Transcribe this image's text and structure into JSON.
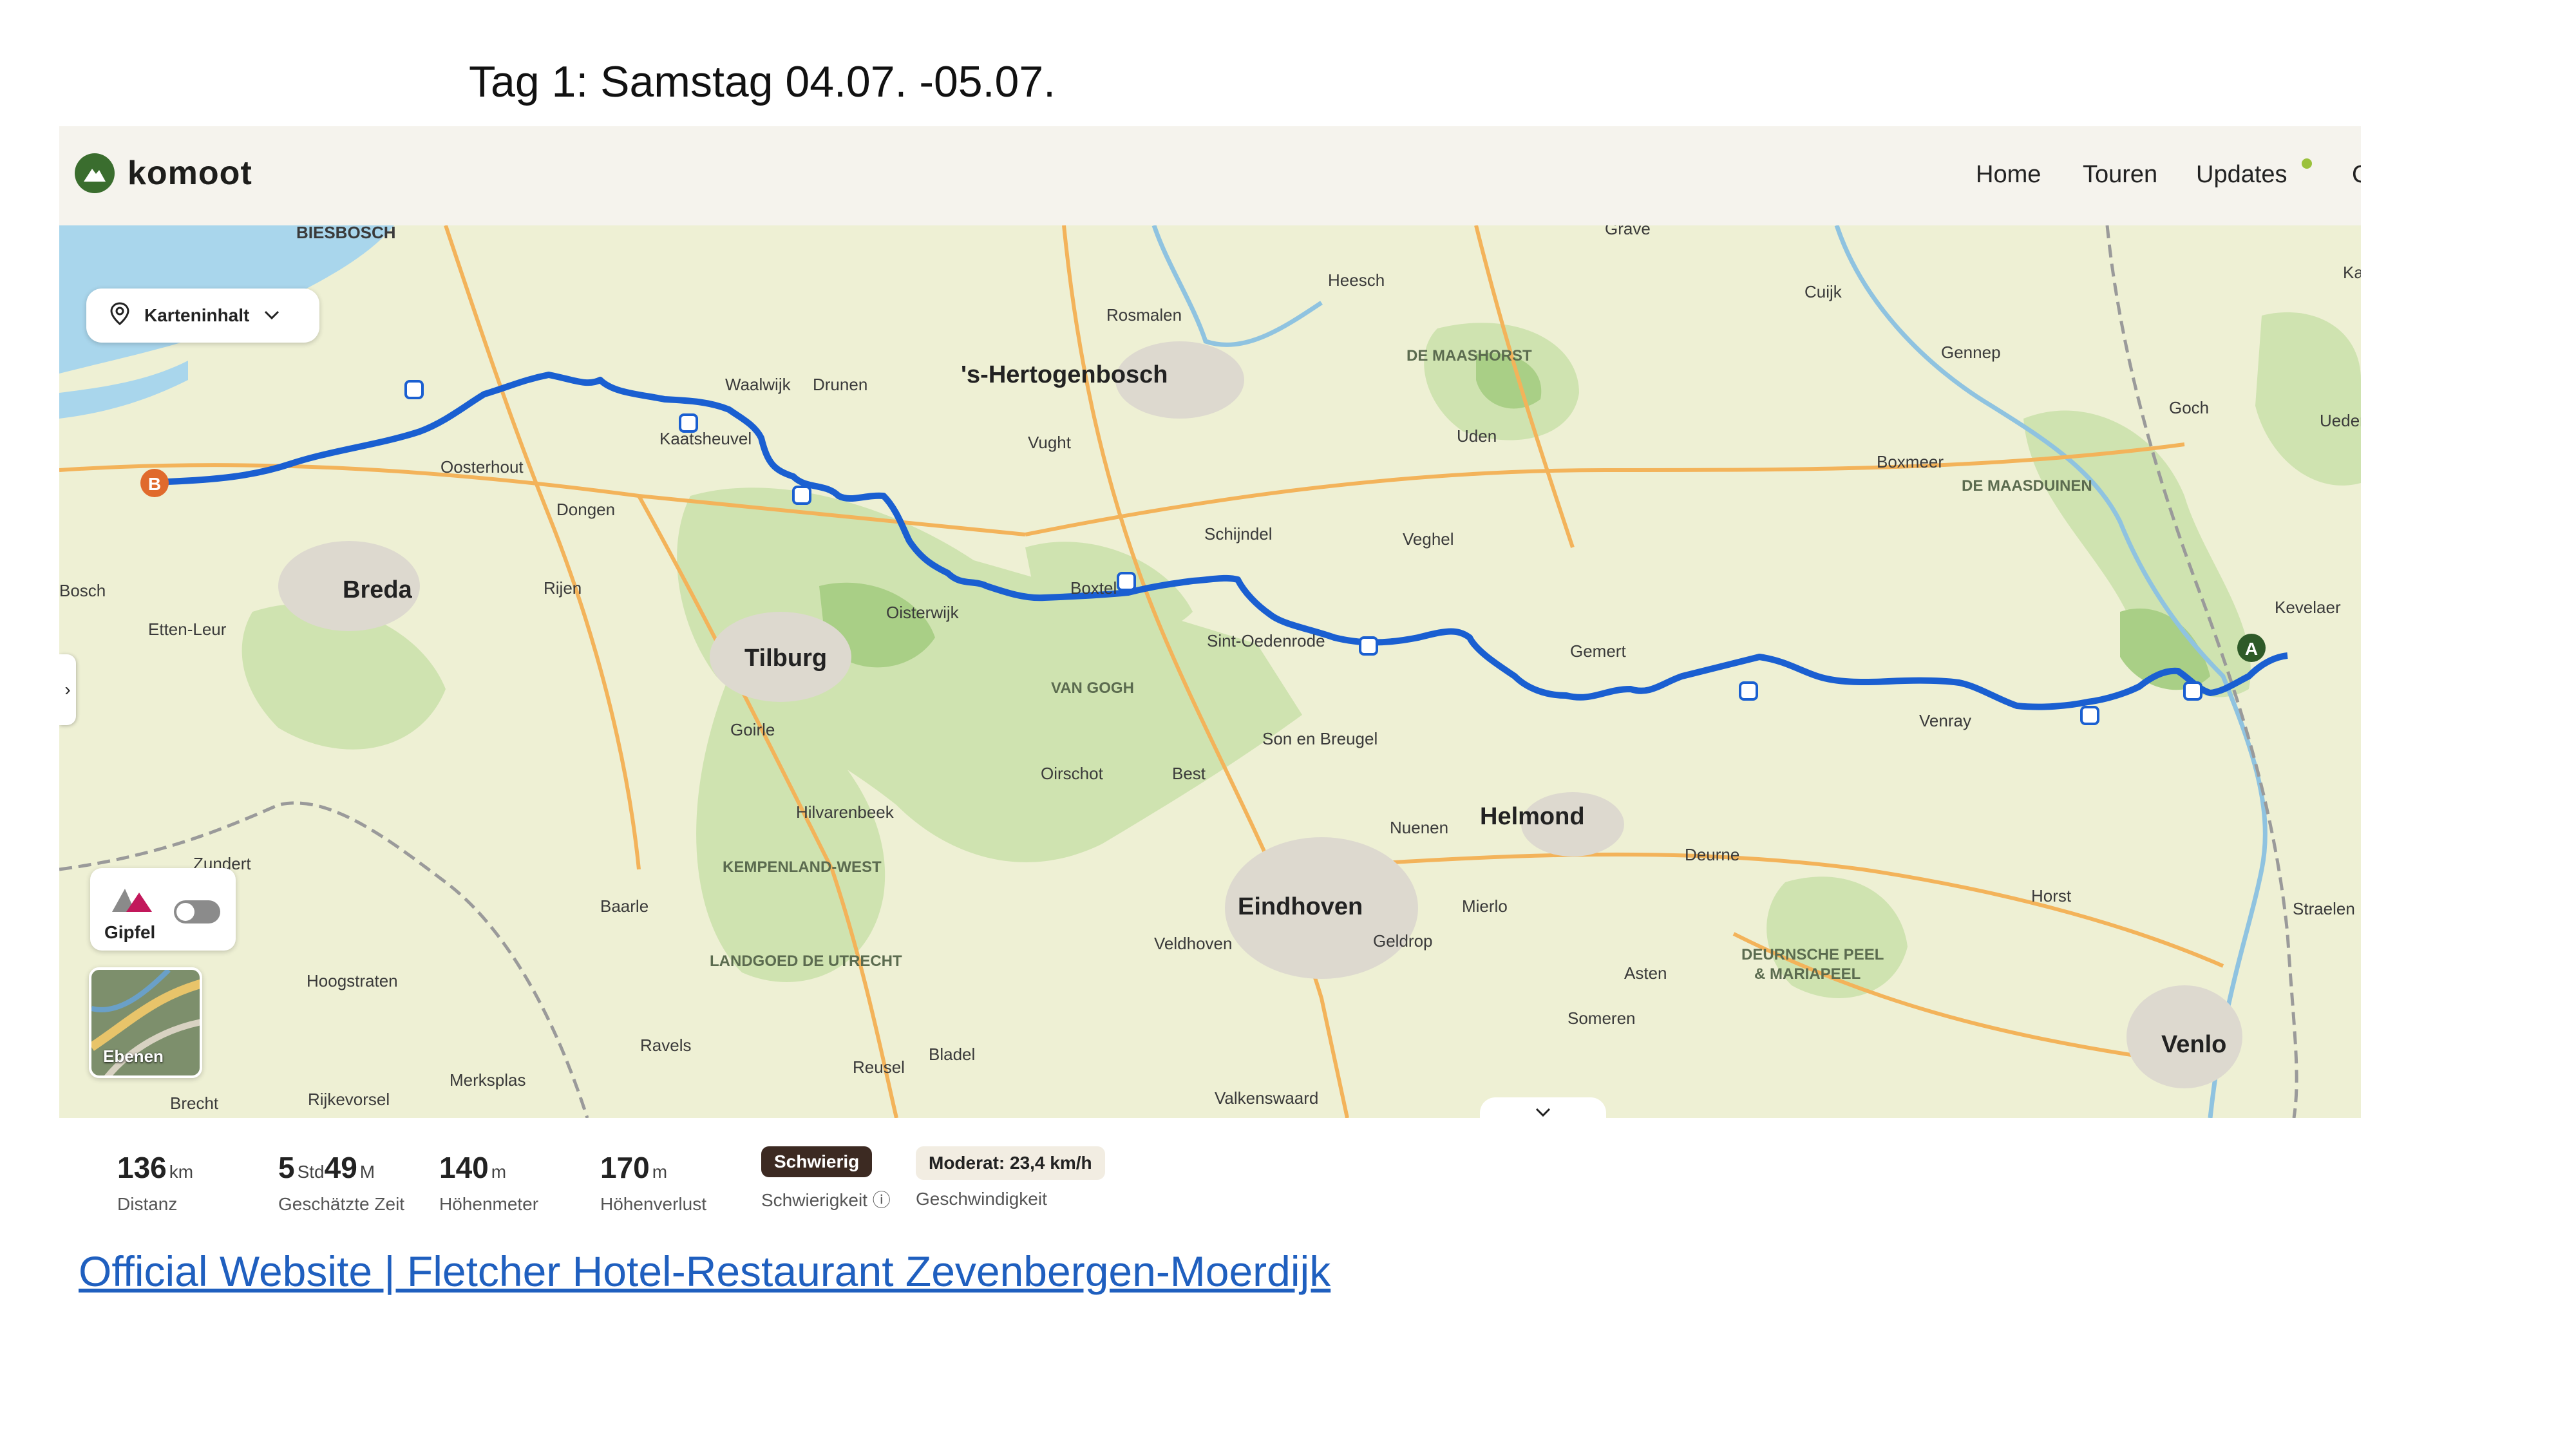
{
  "slide": {
    "title": "Tag 1: Samstag 04.07. -05.07.",
    "link_text": "Official Website | Fletcher Hotel-Restaurant Zevenbergen-Moerdijk"
  },
  "app": {
    "brand": "komoot",
    "nav": [
      "Home",
      "Touren",
      "Updates"
    ],
    "accent": "#3a6d2e",
    "route_color": "#1a5fd1"
  },
  "map": {
    "content_chip": "Karteninhalt",
    "gipfel_label": "Gipfel",
    "layers_label": "Ebenen",
    "start_marker": "A",
    "end_marker": "B",
    "cities": [
      "'s-Hertogenbosch",
      "Breda",
      "Tilburg",
      "Eindhoven",
      "Helmond",
      "Venlo"
    ],
    "towns": [
      "BIESBOSCH",
      "Heesch",
      "Rosmalen",
      "Grave",
      "Cuijk",
      "Gennep",
      "Goch",
      "Uedem",
      "Waalwijk",
      "Drunen",
      "Kaatsheuvel",
      "Oosterhout",
      "Dongen",
      "Vught",
      "Uden",
      "Veghel",
      "Schijndel",
      "Boxmeer",
      "Kevelaer",
      "Rijen",
      "Etten-Leur",
      "Oisterwijk",
      "Boxtel",
      "Sint-Oedenrode",
      "Gemert",
      "Venray",
      "Goirle",
      "Son en Breugel",
      "Oirschot",
      "Best",
      "Hilvarenbeek",
      "Nuenen",
      "Deurne",
      "Zundert",
      "Baarle",
      "Mierlo",
      "Horst",
      "Straelen",
      "Veldhoven",
      "Geldrop",
      "Hoogstraten",
      "Asten",
      "Someren",
      "Ravels",
      "Bladel",
      "Reusel",
      "Merksplas",
      "Rijkevorsel",
      "Brecht",
      "Valkenswaard",
      "Bosch",
      "Ka"
    ],
    "parks": [
      "DE MAASHORST",
      "DE MAASDUINEN",
      "VAN GOGH",
      "KEMPENLAND-WEST",
      "LANDGOED DE UTRECHT",
      "DEURNSCHE PEEL",
      "& MARIAPEEL"
    ]
  },
  "stats": [
    {
      "value": "136",
      "unit": "km",
      "label": "Distanz"
    },
    {
      "value_a": "5",
      "unit_a": "Std",
      "value_b": "49",
      "unit_b": "M",
      "label": "Geschätzte Zeit"
    },
    {
      "value": "140",
      "unit": "m",
      "label": "Höhenmeter"
    },
    {
      "value": "170",
      "unit": "m",
      "label": "Höhenverlust"
    },
    {
      "badge": "Schwierig",
      "label": "Schwierigkeit"
    },
    {
      "badge": "Moderat: 23,4 km/h",
      "label": "Geschwindigkeit"
    }
  ]
}
